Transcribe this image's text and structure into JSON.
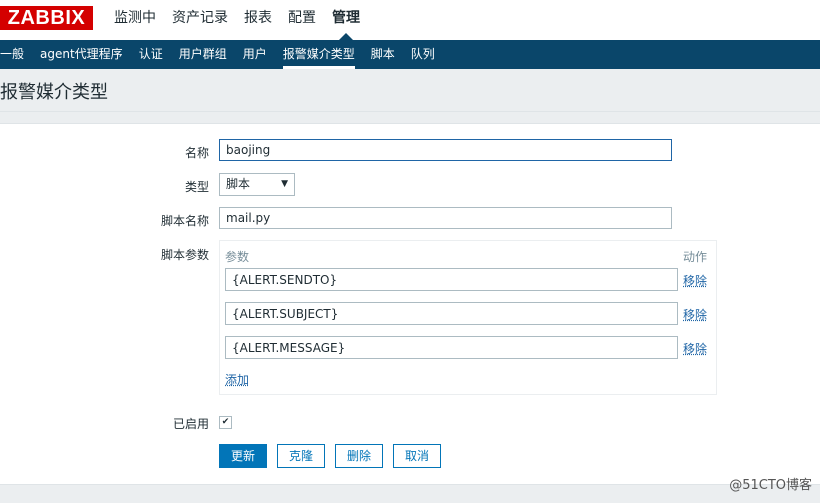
{
  "app": {
    "logo": "ZABBIX"
  },
  "main_nav": [
    {
      "label": "监测中",
      "active": false
    },
    {
      "label": "资产记录",
      "active": false
    },
    {
      "label": "报表",
      "active": false
    },
    {
      "label": "配置",
      "active": false
    },
    {
      "label": "管理",
      "active": true
    }
  ],
  "sub_nav": [
    {
      "label": "一般"
    },
    {
      "label": "agent代理程序"
    },
    {
      "label": "认证"
    },
    {
      "label": "用户群组"
    },
    {
      "label": "用户"
    },
    {
      "label": "报警媒介类型",
      "active": true
    },
    {
      "label": "脚本"
    },
    {
      "label": "队列"
    }
  ],
  "page": {
    "title": "报警媒介类型"
  },
  "form": {
    "name_label": "名称",
    "name_value": "baojing",
    "type_label": "类型",
    "type_value": "脚本",
    "script_name_label": "脚本名称",
    "script_name_value": "mail.py",
    "params_label": "脚本参数",
    "params_header": "参数",
    "action_header": "动作",
    "params": [
      {
        "value": "{ALERT.SENDTO}",
        "remove": "移除"
      },
      {
        "value": "{ALERT.SUBJECT}",
        "remove": "移除"
      },
      {
        "value": "{ALERT.MESSAGE}",
        "remove": "移除"
      }
    ],
    "add_label": "添加",
    "enabled_label": "已启用",
    "enabled": true
  },
  "buttons": {
    "update": "更新",
    "clone": "克隆",
    "delete": "删除",
    "cancel": "取消"
  },
  "watermark": "@51CTO博客"
}
